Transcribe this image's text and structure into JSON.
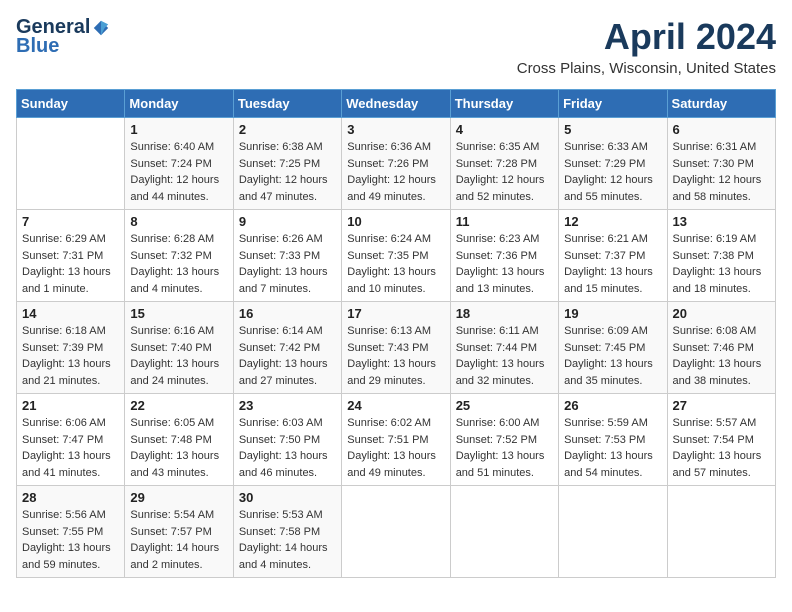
{
  "header": {
    "logo_general": "General",
    "logo_blue": "Blue",
    "title": "April 2024",
    "location": "Cross Plains, Wisconsin, United States"
  },
  "weekdays": [
    "Sunday",
    "Monday",
    "Tuesday",
    "Wednesday",
    "Thursday",
    "Friday",
    "Saturday"
  ],
  "weeks": [
    [
      {
        "day": "",
        "info": ""
      },
      {
        "day": "1",
        "info": "Sunrise: 6:40 AM\nSunset: 7:24 PM\nDaylight: 12 hours\nand 44 minutes."
      },
      {
        "day": "2",
        "info": "Sunrise: 6:38 AM\nSunset: 7:25 PM\nDaylight: 12 hours\nand 47 minutes."
      },
      {
        "day": "3",
        "info": "Sunrise: 6:36 AM\nSunset: 7:26 PM\nDaylight: 12 hours\nand 49 minutes."
      },
      {
        "day": "4",
        "info": "Sunrise: 6:35 AM\nSunset: 7:28 PM\nDaylight: 12 hours\nand 52 minutes."
      },
      {
        "day": "5",
        "info": "Sunrise: 6:33 AM\nSunset: 7:29 PM\nDaylight: 12 hours\nand 55 minutes."
      },
      {
        "day": "6",
        "info": "Sunrise: 6:31 AM\nSunset: 7:30 PM\nDaylight: 12 hours\nand 58 minutes."
      }
    ],
    [
      {
        "day": "7",
        "info": "Sunrise: 6:29 AM\nSunset: 7:31 PM\nDaylight: 13 hours\nand 1 minute."
      },
      {
        "day": "8",
        "info": "Sunrise: 6:28 AM\nSunset: 7:32 PM\nDaylight: 13 hours\nand 4 minutes."
      },
      {
        "day": "9",
        "info": "Sunrise: 6:26 AM\nSunset: 7:33 PM\nDaylight: 13 hours\nand 7 minutes."
      },
      {
        "day": "10",
        "info": "Sunrise: 6:24 AM\nSunset: 7:35 PM\nDaylight: 13 hours\nand 10 minutes."
      },
      {
        "day": "11",
        "info": "Sunrise: 6:23 AM\nSunset: 7:36 PM\nDaylight: 13 hours\nand 13 minutes."
      },
      {
        "day": "12",
        "info": "Sunrise: 6:21 AM\nSunset: 7:37 PM\nDaylight: 13 hours\nand 15 minutes."
      },
      {
        "day": "13",
        "info": "Sunrise: 6:19 AM\nSunset: 7:38 PM\nDaylight: 13 hours\nand 18 minutes."
      }
    ],
    [
      {
        "day": "14",
        "info": "Sunrise: 6:18 AM\nSunset: 7:39 PM\nDaylight: 13 hours\nand 21 minutes."
      },
      {
        "day": "15",
        "info": "Sunrise: 6:16 AM\nSunset: 7:40 PM\nDaylight: 13 hours\nand 24 minutes."
      },
      {
        "day": "16",
        "info": "Sunrise: 6:14 AM\nSunset: 7:42 PM\nDaylight: 13 hours\nand 27 minutes."
      },
      {
        "day": "17",
        "info": "Sunrise: 6:13 AM\nSunset: 7:43 PM\nDaylight: 13 hours\nand 29 minutes."
      },
      {
        "day": "18",
        "info": "Sunrise: 6:11 AM\nSunset: 7:44 PM\nDaylight: 13 hours\nand 32 minutes."
      },
      {
        "day": "19",
        "info": "Sunrise: 6:09 AM\nSunset: 7:45 PM\nDaylight: 13 hours\nand 35 minutes."
      },
      {
        "day": "20",
        "info": "Sunrise: 6:08 AM\nSunset: 7:46 PM\nDaylight: 13 hours\nand 38 minutes."
      }
    ],
    [
      {
        "day": "21",
        "info": "Sunrise: 6:06 AM\nSunset: 7:47 PM\nDaylight: 13 hours\nand 41 minutes."
      },
      {
        "day": "22",
        "info": "Sunrise: 6:05 AM\nSunset: 7:48 PM\nDaylight: 13 hours\nand 43 minutes."
      },
      {
        "day": "23",
        "info": "Sunrise: 6:03 AM\nSunset: 7:50 PM\nDaylight: 13 hours\nand 46 minutes."
      },
      {
        "day": "24",
        "info": "Sunrise: 6:02 AM\nSunset: 7:51 PM\nDaylight: 13 hours\nand 49 minutes."
      },
      {
        "day": "25",
        "info": "Sunrise: 6:00 AM\nSunset: 7:52 PM\nDaylight: 13 hours\nand 51 minutes."
      },
      {
        "day": "26",
        "info": "Sunrise: 5:59 AM\nSunset: 7:53 PM\nDaylight: 13 hours\nand 54 minutes."
      },
      {
        "day": "27",
        "info": "Sunrise: 5:57 AM\nSunset: 7:54 PM\nDaylight: 13 hours\nand 57 minutes."
      }
    ],
    [
      {
        "day": "28",
        "info": "Sunrise: 5:56 AM\nSunset: 7:55 PM\nDaylight: 13 hours\nand 59 minutes."
      },
      {
        "day": "29",
        "info": "Sunrise: 5:54 AM\nSunset: 7:57 PM\nDaylight: 14 hours\nand 2 minutes."
      },
      {
        "day": "30",
        "info": "Sunrise: 5:53 AM\nSunset: 7:58 PM\nDaylight: 14 hours\nand 4 minutes."
      },
      {
        "day": "",
        "info": ""
      },
      {
        "day": "",
        "info": ""
      },
      {
        "day": "",
        "info": ""
      },
      {
        "day": "",
        "info": ""
      }
    ]
  ]
}
